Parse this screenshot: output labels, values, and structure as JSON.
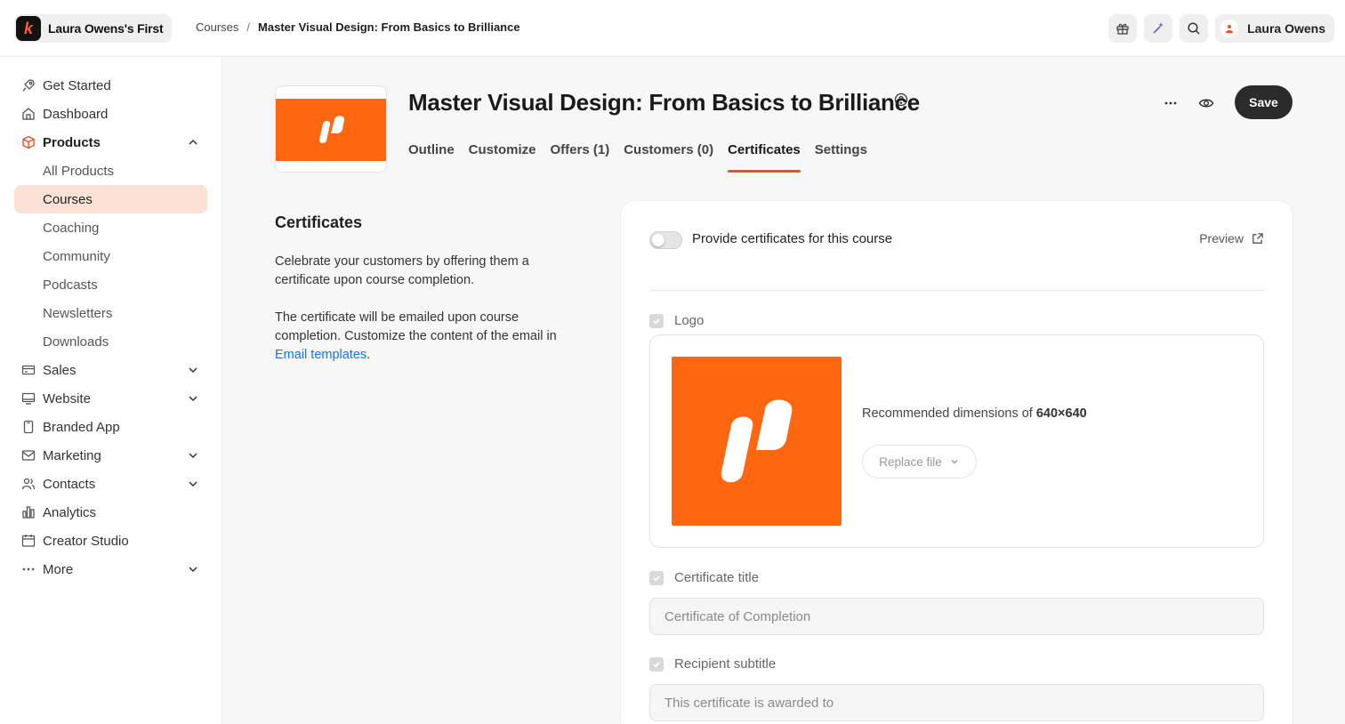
{
  "brand": {
    "logo_letter": "k",
    "name": "Laura Owens's First"
  },
  "breadcrumb": {
    "parent": "Courses",
    "separator": "/",
    "current": "Master Visual Design: From Basics to Brilliance"
  },
  "user": {
    "name": "Laura Owens"
  },
  "sidebar": {
    "items": [
      {
        "label": "Get Started",
        "icon": "rocket-icon"
      },
      {
        "label": "Dashboard",
        "icon": "home-icon"
      },
      {
        "label": "Products",
        "icon": "box-icon",
        "expanded": true
      },
      {
        "label": "All Products"
      },
      {
        "label": "Courses",
        "active": true
      },
      {
        "label": "Coaching"
      },
      {
        "label": "Community"
      },
      {
        "label": "Podcasts"
      },
      {
        "label": "Newsletters"
      },
      {
        "label": "Downloads"
      },
      {
        "label": "Sales",
        "icon": "card-icon"
      },
      {
        "label": "Website",
        "icon": "monitor-icon"
      },
      {
        "label": "Branded App",
        "icon": "phone-icon"
      },
      {
        "label": "Marketing",
        "icon": "mail-icon"
      },
      {
        "label": "Contacts",
        "icon": "users-icon"
      },
      {
        "label": "Analytics",
        "icon": "bar-chart-icon"
      },
      {
        "label": "Creator Studio",
        "icon": "calendar-icon"
      },
      {
        "label": "More",
        "icon": "dots-icon"
      }
    ]
  },
  "header": {
    "title": "Master Visual Design: From Basics to Brilliance",
    "save_label": "Save",
    "tabs": [
      {
        "label": "Outline"
      },
      {
        "label": "Customize"
      },
      {
        "label": "Offers (1)"
      },
      {
        "label": "Customers (0)"
      },
      {
        "label": "Certificates",
        "active": true
      },
      {
        "label": "Settings"
      }
    ]
  },
  "certificates": {
    "heading": "Certificates",
    "desc1": "Celebrate your customers by offering them a certificate upon course completion.",
    "desc2_prefix": "The certificate will be emailed upon course completion. Customize the content of the email in ",
    "desc2_link": "Email templates",
    "desc2_suffix": ".",
    "toggle_label": "Provide certificates for this course",
    "toggle_on": false,
    "preview_label": "Preview",
    "logo_label": "Logo",
    "rec_prefix": "Recommended dimensions of ",
    "rec_dims": "640×640",
    "replace_label": "Replace file",
    "title_label": "Certificate title",
    "title_value": "Certificate of Completion",
    "subtitle_label": "Recipient subtitle",
    "subtitle_value": "This certificate is awarded to"
  },
  "colors": {
    "accent": "#f04e23",
    "brand_orange": "#ff6610",
    "active_bg": "#fde1d6",
    "link": "#1a73e8"
  }
}
